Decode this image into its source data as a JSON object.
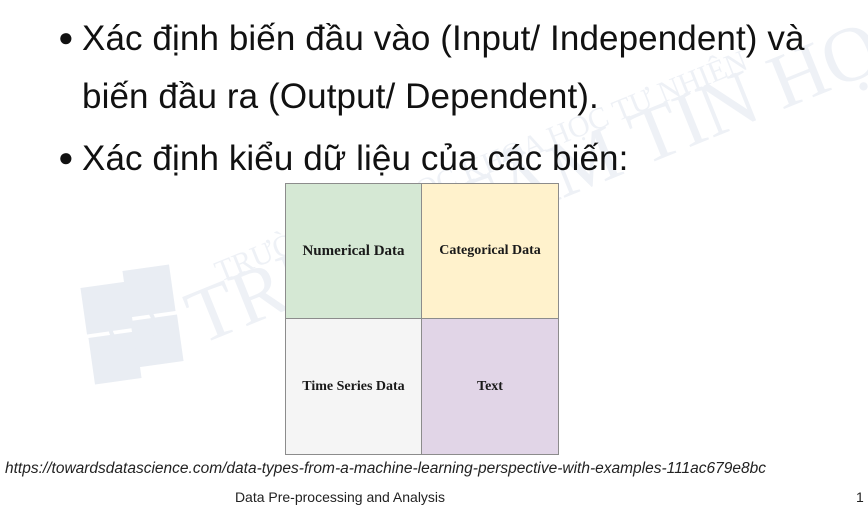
{
  "slide": {
    "bullets": [
      {
        "line1": "Xác định biến đầu vào (Input/ Independent) và",
        "line2": "biến đầu ra (Output/ Dependent)."
      },
      {
        "line1": "Xác định kiểu dữ liệu của các biến:"
      }
    ],
    "bullet_symbol": "●"
  },
  "data_types_grid": {
    "cells": [
      {
        "label": "Numerical Data",
        "color": "#d5e8d4"
      },
      {
        "label": "Categorical Data",
        "color": "#fff2cc"
      },
      {
        "label": "Time Series Data",
        "color": "#f5f5f5"
      },
      {
        "label": "Text",
        "color": "#e1d5e7"
      }
    ]
  },
  "source": {
    "url": "https://towardsdatascience.com/data-types-from-a-machine-learning-perspective-with-examples-111ac679e8bc"
  },
  "footer": {
    "title": "Data Pre-processing and Analysis",
    "page_number": "1"
  },
  "watermark": {
    "logo_letters": [
      "T",
      "T",
      "T",
      "H"
    ],
    "text_top": "TRƯỜNG ĐẠI HỌC KHOA HỌC TỰ NHIÊN",
    "text_main": "TRUNG TÂM TIN HỌC",
    "color": "#e9edf3"
  }
}
